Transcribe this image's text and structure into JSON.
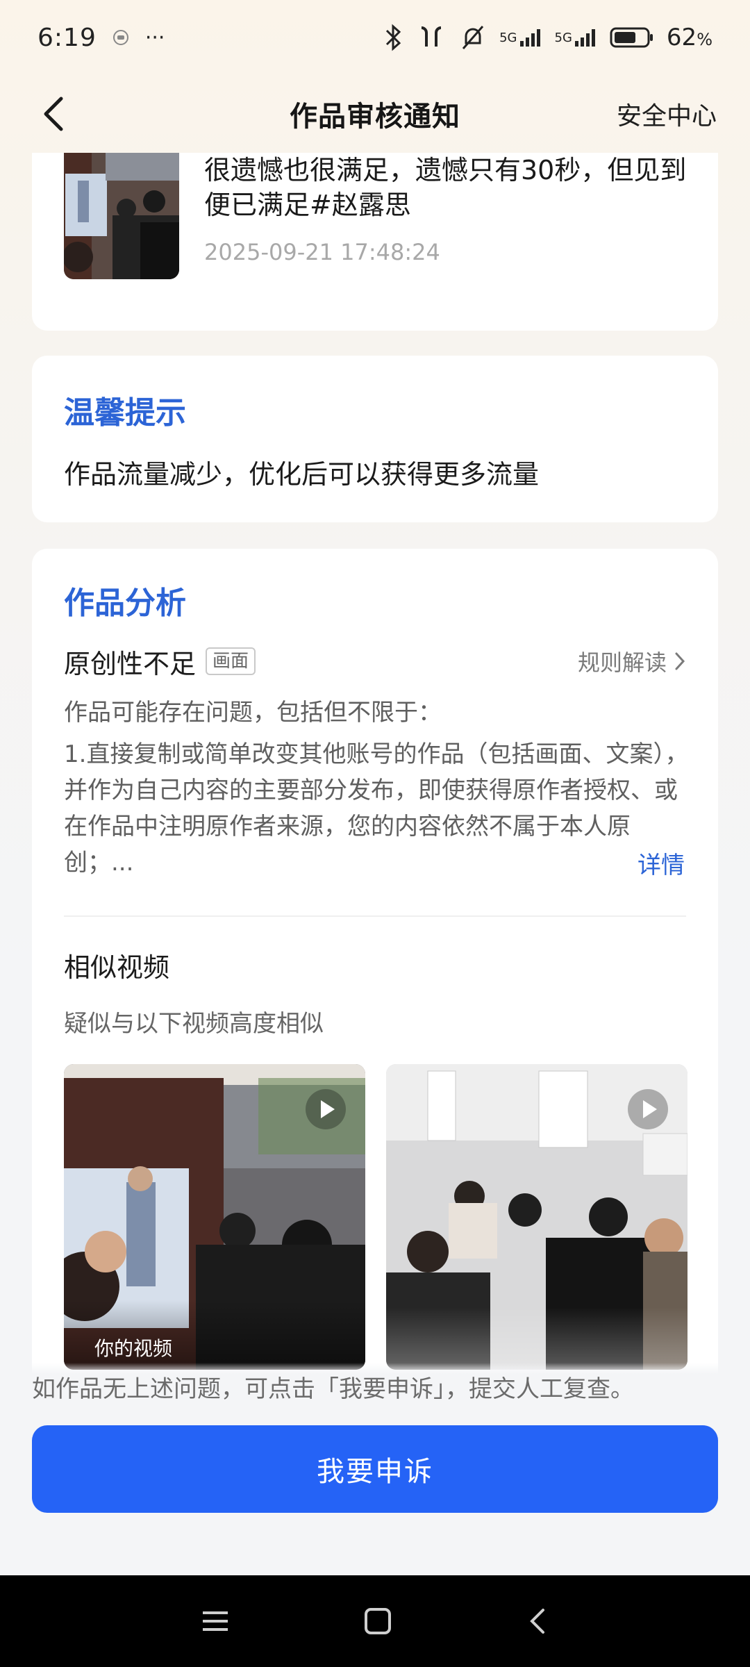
{
  "status_bar": {
    "time": "6:19",
    "more": "···",
    "network_1": "5G",
    "network_2": "5G",
    "battery_percent": "62",
    "battery_unit": "%",
    "icons": [
      "coin-icon",
      "bluetooth-icon",
      "earbuds-icon",
      "mute-bell-icon",
      "signal-icon",
      "battery-icon"
    ]
  },
  "header": {
    "title": "作品审核通知",
    "right_link": "安全中心"
  },
  "work": {
    "description": "很遗憾也很满足，遗憾只有30秒，但见到便已满足#赵露思",
    "timestamp": "2025-09-21 17:48:24"
  },
  "tip": {
    "title": "温馨提示",
    "text": "作品流量减少，优化后可以获得更多流量"
  },
  "analysis": {
    "title": "作品分析",
    "issue_label": "原创性不足",
    "issue_tag": "画面",
    "rules_link": "规则解读",
    "may_issue": "作品可能存在问题，包括但不限于：",
    "issue_desc": "1.直接复制或简单改变其他账号的作品（包括画面、文案），并作为自己内容的主要部分发布，即使获得原作者授权、或在作品中注明原作者来源，您的内容依然不属于本人原创；...",
    "detail_link": "详情",
    "similar_title": "相似视频",
    "similar_sub": "疑似与以下视频高度相似",
    "your_video_label": "你的视频"
  },
  "footer": {
    "hint": "如作品无上述问题，可点击「我要申诉」，提交人工复查。",
    "appeal_button": "我要申诉"
  },
  "colors": {
    "accent_blue": "#2563f6",
    "title_blue": "#2c64d6"
  }
}
